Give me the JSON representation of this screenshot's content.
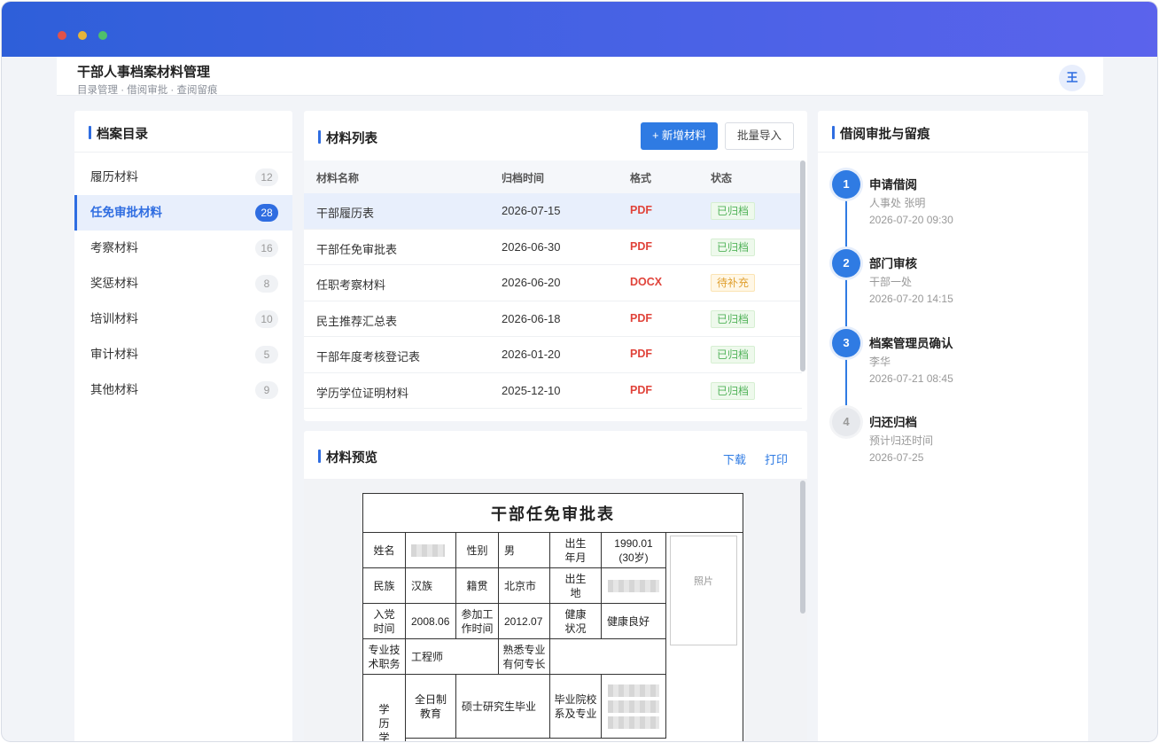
{
  "header": {
    "title": "干部人事档案材料管理",
    "subtitle": "目录管理 · 借阅审批 · 查阅留痕",
    "avatar": "王"
  },
  "catalog": {
    "title": "档案目录",
    "items": [
      {
        "label": "履历材料",
        "count": "12"
      },
      {
        "label": "任免审批材料",
        "count": "28",
        "active": true
      },
      {
        "label": "考察材料",
        "count": "16"
      },
      {
        "label": "奖惩材料",
        "count": "8"
      },
      {
        "label": "培训材料",
        "count": "10"
      },
      {
        "label": "审计材料",
        "count": "5"
      },
      {
        "label": "其他材料",
        "count": "9"
      }
    ]
  },
  "materials": {
    "title": "材料列表",
    "add_button": "+ 新增材料",
    "import_button": "批量导入",
    "columns": [
      "材料名称",
      "归档时间",
      "格式",
      "状态"
    ],
    "rows": [
      {
        "name": "干部履历表",
        "date": "2026-07-15",
        "format": "PDF",
        "status": "已归档",
        "status_type": "ok"
      },
      {
        "name": "干部任免审批表",
        "date": "2026-06-30",
        "format": "PDF",
        "status": "已归档",
        "status_type": "ok"
      },
      {
        "name": "任职考察材料",
        "date": "2026-06-20",
        "format": "DOCX",
        "status": "待补充",
        "status_type": "pend"
      },
      {
        "name": "民主推荐汇总表",
        "date": "2026-06-18",
        "format": "PDF",
        "status": "已归档",
        "status_type": "ok"
      },
      {
        "name": "干部年度考核登记表",
        "date": "2026-01-20",
        "format": "PDF",
        "status": "已归档",
        "status_type": "ok"
      },
      {
        "name": "学历学位证明材料",
        "date": "2025-12-10",
        "format": "PDF",
        "status": "已归档",
        "status_type": "ok"
      }
    ]
  },
  "preview": {
    "title": "材料预览",
    "download": "下载",
    "print": "打印",
    "doc": {
      "title": "干部任免审批表",
      "name_label": "姓名",
      "gender_label": "性别",
      "gender": "男",
      "birth_label": "出生年月",
      "birth": "1990.01 (30岁)",
      "photo": "照片",
      "ethnic_label": "民族",
      "ethnic": "汉族",
      "origin_label": "籍贯",
      "origin": "北京市",
      "birthplace_label": "出生地",
      "party_label": "入党时间",
      "party": "2008.06",
      "work_label": "参加工作时间",
      "work": "2012.07",
      "health_label": "健康状况",
      "health": "健康良好",
      "title_label": "专业技术职务",
      "tech_title": "工程师",
      "specialty_label": "熟悉专业有何专长",
      "edu_label": "学历学位",
      "fulltime_label": "全日制教育",
      "fulltime": "硕士研究生毕业",
      "school_label": "毕业院校系及专业"
    }
  },
  "approval": {
    "title": "借阅审批与留痕",
    "steps": [
      {
        "num": "1",
        "title": "申请借阅",
        "person": "人事处 张明",
        "time": "2026-07-20 09:30",
        "done": true
      },
      {
        "num": "2",
        "title": "部门审核",
        "person": "干部一处",
        "time": "2026-07-20 14:15",
        "done": true
      },
      {
        "num": "3",
        "title": "档案管理员确认",
        "person": "李华",
        "time": "2026-07-21 08:45",
        "done": true
      },
      {
        "num": "4",
        "title": "归还归档",
        "person": "预计归还时间",
        "time": "2026-07-25",
        "done": false
      }
    ]
  }
}
